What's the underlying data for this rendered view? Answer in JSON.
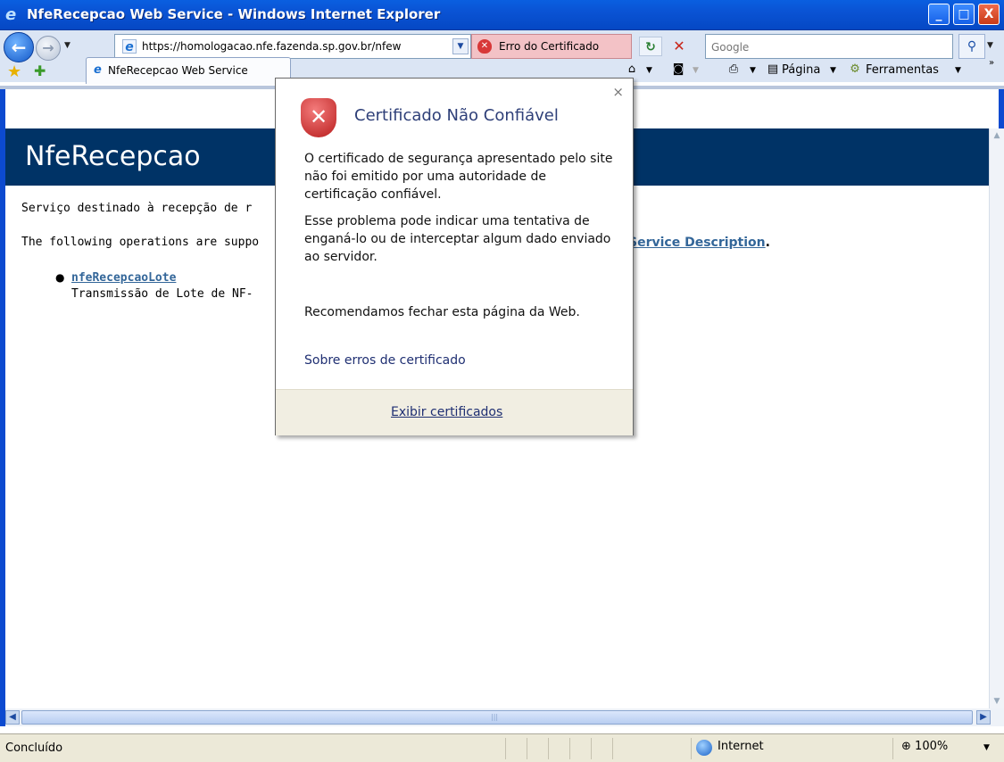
{
  "window": {
    "title": "NfeRecepcao Web Service - Windows Internet Explorer",
    "min_glyph": "_",
    "max_glyph": "□",
    "close_glyph": "X"
  },
  "toolbar": {
    "url": "https://homologacao.nfe.fazenda.sp.gov.br/nfew",
    "cert_error": "Erro do Certificado",
    "search_placeholder": "Google"
  },
  "tabs": [
    {
      "label": "NfeRecepcao Web Service"
    }
  ],
  "commandbar": {
    "page_label": "Página",
    "tools_label": "Ferramentas"
  },
  "page": {
    "heading": "NfeRecepcao",
    "description": "Serviço destinado à recepção de r",
    "operations_text": "The following operations are suppo",
    "service_description_link": "Service Description",
    "operations": [
      {
        "name": "nfeRecepcaoLote",
        "description": "Transmissão de Lote de NF-"
      }
    ]
  },
  "popup": {
    "title": "Certificado Não Confiável",
    "paragraph1": "O certificado de segurança apresentado pelo site não foi emitido por uma autoridade de certificação confiável.",
    "paragraph2": "Esse problema pode indicar uma tentativa de enganá-lo ou de interceptar algum dado enviado ao servidor.",
    "paragraph3": "Recomendamos fechar esta página da Web.",
    "about_link": "Sobre erros de certificado",
    "view_certs_link": "Exibir certificados",
    "close_glyph": "×"
  },
  "statusbar": {
    "status": "Concluído",
    "zone": "Internet",
    "zoom": "100%"
  },
  "colors": {
    "page_header_bg": "#003366",
    "link": "#336699",
    "cert_error_bg": "#f3c2c6"
  }
}
